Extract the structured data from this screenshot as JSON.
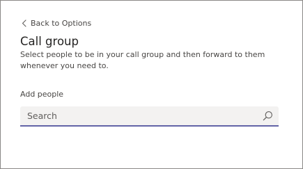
{
  "nav": {
    "back_label": "Back to Options",
    "back_icon": "chevron-left-icon"
  },
  "page": {
    "title": "Call group",
    "description": "Select people to be in your call group and then forward to them whenever you need to."
  },
  "add_people": {
    "label": "Add people",
    "search_placeholder": "Search",
    "search_value": "",
    "search_icon": "search-icon"
  },
  "colors": {
    "accent": "#6264a7",
    "input_background": "#f3f2f1",
    "text_primary": "#252423",
    "text_secondary": "#484644",
    "frame_border": "#8a8886"
  }
}
